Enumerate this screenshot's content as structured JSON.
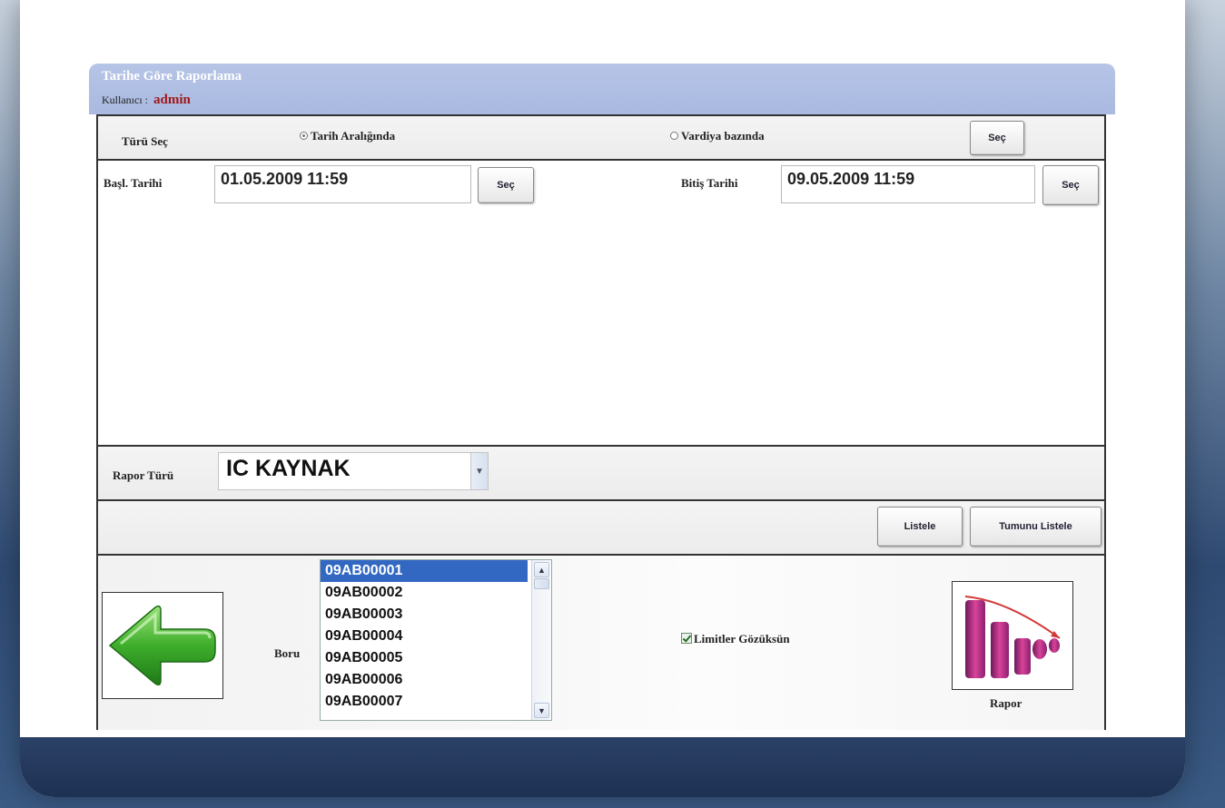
{
  "header": {
    "title": "Tarihe Göre Raporlama",
    "user_label": "Kullanıcı :",
    "user_name": "admin"
  },
  "type_row": {
    "label": "Türü Seç",
    "radio_date_range": {
      "label": "Tarih Aralığında",
      "selected": true
    },
    "radio_shift": {
      "label": "Vardiya bazında",
      "selected": false
    },
    "select_button": "Seç"
  },
  "dates": {
    "start_label": "Başl. Tarihi",
    "start_value": "01.05.2009 11:59",
    "start_button": "Seç",
    "end_label": "Bitiş Tarihi",
    "end_value": "09.05.2009 11:59",
    "end_button": "Seç"
  },
  "report_type": {
    "label": "Rapor Türü",
    "selected": "IC KAYNAK"
  },
  "actions": {
    "list_button": "Listele",
    "list_all_button": "Tumunu Listele"
  },
  "bottom": {
    "boru_label": "Boru",
    "pipes": [
      "09AB00001",
      "09AB00002",
      "09AB00003",
      "09AB00004",
      "09AB00005",
      "09AB00006",
      "09AB00007"
    ],
    "selected_pipe": "09AB00001",
    "limits_checkbox": {
      "label": "Limitler Gözüksün",
      "checked": true
    },
    "report_label": "Rapor"
  },
  "icons": {
    "back": "back-arrow-icon",
    "report": "report-chart-icon"
  },
  "colors": {
    "header_bg": "#b0bfe4",
    "user_name": "#a01818",
    "list_selected": "#3368c2"
  }
}
